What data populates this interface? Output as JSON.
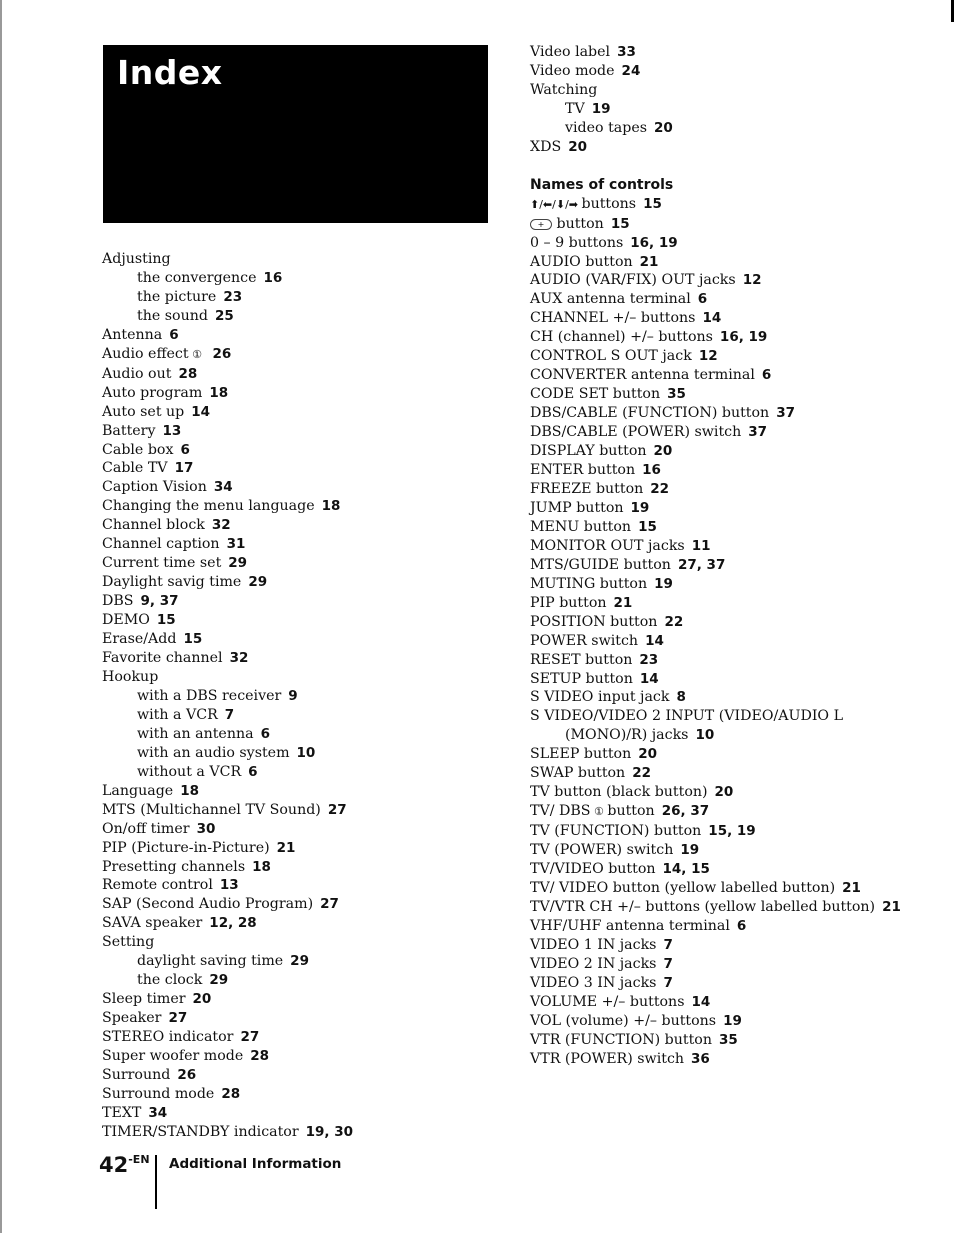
{
  "page": {
    "title": "Index",
    "footer": {
      "page_number": "42",
      "page_suffix": "-EN",
      "section": "Additional Information"
    }
  },
  "left_column": [
    {
      "term": "Adjusting",
      "pages": "",
      "level": 0
    },
    {
      "term": "the convergence",
      "pages": "16",
      "level": 1
    },
    {
      "term": "the picture",
      "pages": "23",
      "level": 1
    },
    {
      "term": "the sound",
      "pages": "25",
      "level": 1
    },
    {
      "term": "Antenna",
      "pages": "6",
      "level": 0
    },
    {
      "term": "Audio effect",
      "icon": "surround-icon",
      "icon_glyph": "①",
      "pages": "26",
      "level": 0
    },
    {
      "term": "Audio out",
      "pages": "28",
      "level": 0
    },
    {
      "term": "Auto program",
      "pages": "18",
      "level": 0
    },
    {
      "term": "Auto set up",
      "pages": "14",
      "level": 0
    },
    {
      "term": "Battery",
      "pages": "13",
      "level": 0
    },
    {
      "term": "Cable box",
      "pages": "6",
      "level": 0
    },
    {
      "term": "Cable TV",
      "pages": "17",
      "level": 0
    },
    {
      "term": "Caption Vision",
      "pages": "34",
      "level": 0
    },
    {
      "term": "Changing the menu language",
      "pages": "18",
      "level": 0
    },
    {
      "term": "Channel block",
      "pages": "32",
      "level": 0
    },
    {
      "term": "Channel caption",
      "pages": "31",
      "level": 0
    },
    {
      "term": "Current time set",
      "pages": "29",
      "level": 0
    },
    {
      "term": "Daylight savig time",
      "pages": "29",
      "level": 0
    },
    {
      "term": "DBS",
      "pages": "9, 37",
      "level": 0
    },
    {
      "term": "DEMO",
      "pages": "15",
      "level": 0
    },
    {
      "term": "Erase/Add",
      "pages": "15",
      "level": 0
    },
    {
      "term": "Favorite channel",
      "pages": "32",
      "level": 0
    },
    {
      "term": "Hookup",
      "pages": "",
      "level": 0
    },
    {
      "term": "with a DBS receiver",
      "pages": "9",
      "level": 1
    },
    {
      "term": "with a VCR",
      "pages": "7",
      "level": 1
    },
    {
      "term": "with an antenna",
      "pages": "6",
      "level": 1
    },
    {
      "term": "with an audio system",
      "pages": "10",
      "level": 1
    },
    {
      "term": "without a VCR",
      "pages": "6",
      "level": 1
    },
    {
      "term": "Language",
      "pages": "18",
      "level": 0
    },
    {
      "term": "MTS (Multichannel TV Sound)",
      "pages": "27",
      "level": 0
    },
    {
      "term": "On/off timer",
      "pages": "30",
      "level": 0
    },
    {
      "term": "PIP (Picture-in-Picture)",
      "pages": "21",
      "level": 0
    },
    {
      "term": "Presetting channels",
      "pages": "18",
      "level": 0
    },
    {
      "term": "Remote control",
      "pages": "13",
      "level": 0
    },
    {
      "term": "SAP (Second Audio Program)",
      "pages": "27",
      "level": 0
    },
    {
      "term": "SAVA speaker",
      "pages": "12, 28",
      "level": 0
    },
    {
      "term": "Setting",
      "pages": "",
      "level": 0
    },
    {
      "term": "daylight saving time",
      "pages": "29",
      "level": 1
    },
    {
      "term": "the clock",
      "pages": "29",
      "level": 1
    },
    {
      "term": "Sleep timer",
      "pages": "20",
      "level": 0
    },
    {
      "term": "Speaker",
      "pages": "27",
      "level": 0
    },
    {
      "term": "STEREO indicator",
      "pages": "27",
      "level": 0
    },
    {
      "term": "Super woofer mode",
      "pages": "28",
      "level": 0
    },
    {
      "term": "Surround",
      "pages": "26",
      "level": 0
    },
    {
      "term": "Surround mode",
      "pages": "28",
      "level": 0
    },
    {
      "term": "TEXT",
      "pages": "34",
      "level": 0
    },
    {
      "term": "TIMER/STANDBY indicator",
      "pages": "19, 30",
      "level": 0
    }
  ],
  "right_column": [
    {
      "term": "Video label",
      "pages": "33",
      "level": 0
    },
    {
      "term": "Video mode",
      "pages": "24",
      "level": 0
    },
    {
      "term": "Watching",
      "pages": "",
      "level": 0
    },
    {
      "term": "TV",
      "pages": "19",
      "level": 1
    },
    {
      "term": "video tapes",
      "pages": "20",
      "level": 1
    },
    {
      "term": "XDS",
      "pages": "20",
      "level": 0
    }
  ],
  "controls_section": {
    "heading": "Names of controls",
    "entries": [
      {
        "term": "buttons",
        "prefix_icons": "⬆/⬅/⬇/➡",
        "pages": "15",
        "level": 0
      },
      {
        "term": "button",
        "prefix_pill": "+",
        "pages": "15",
        "level": 0
      },
      {
        "term": "0 – 9 buttons",
        "pages": "16, 19",
        "level": 0
      },
      {
        "term": "AUDIO button",
        "pages": "21",
        "level": 0
      },
      {
        "term": "AUDIO (VAR/FIX) OUT jacks",
        "pages": "12",
        "level": 0
      },
      {
        "term": "AUX antenna terminal",
        "pages": "6",
        "level": 0
      },
      {
        "term": "CHANNEL +/– buttons",
        "pages": "14",
        "level": 0
      },
      {
        "term": "CH (channel) +/– buttons",
        "pages": "16, 19",
        "level": 0
      },
      {
        "term": "CONTROL S OUT jack",
        "pages": "12",
        "level": 0
      },
      {
        "term": "CONVERTER antenna terminal",
        "pages": "6",
        "level": 0
      },
      {
        "term": "CODE SET button",
        "pages": "35",
        "level": 0
      },
      {
        "term": "DBS/CABLE (FUNCTION) button",
        "pages": "37",
        "level": 0
      },
      {
        "term": "DBS/CABLE (POWER) switch",
        "pages": "37",
        "level": 0
      },
      {
        "term": "DISPLAY button",
        "pages": "20",
        "level": 0
      },
      {
        "term": "ENTER button",
        "pages": "16",
        "level": 0
      },
      {
        "term": "FREEZE button",
        "pages": "22",
        "level": 0
      },
      {
        "term": "JUMP button",
        "pages": "19",
        "level": 0
      },
      {
        "term": "MENU button",
        "pages": "15",
        "level": 0
      },
      {
        "term": "MONITOR OUT jacks",
        "pages": "11",
        "level": 0
      },
      {
        "term": "MTS/GUIDE button",
        "pages": "27, 37",
        "level": 0
      },
      {
        "term": "MUTING button",
        "pages": "19",
        "level": 0
      },
      {
        "term": "PIP button",
        "pages": "21",
        "level": 0
      },
      {
        "term": "POSITION button",
        "pages": "22",
        "level": 0
      },
      {
        "term": "POWER switch",
        "pages": "14",
        "level": 0
      },
      {
        "term": "RESET button",
        "pages": "23",
        "level": 0
      },
      {
        "term": "SETUP button",
        "pages": "14",
        "level": 0
      },
      {
        "term": "S VIDEO input jack",
        "pages": "8",
        "level": 0
      },
      {
        "term": "S VIDEO/VIDEO 2 INPUT (VIDEO/AUDIO  L",
        "pages": "",
        "level": 0
      },
      {
        "term": "(MONO)/R) jacks",
        "pages": "10",
        "level": 2
      },
      {
        "term": "SLEEP button",
        "pages": "20",
        "level": 0
      },
      {
        "term": "SWAP button",
        "pages": "22",
        "level": 0
      },
      {
        "term": "TV button (black button)",
        "pages": "20",
        "level": 0
      },
      {
        "term": "TV/ DBS",
        "icon": "surround-icon",
        "icon_glyph": "①",
        "term_after": "button",
        "pages": "26, 37",
        "level": 0
      },
      {
        "term": "TV (FUNCTION) button",
        "pages": "15, 19",
        "level": 0
      },
      {
        "term": "TV (POWER) switch",
        "pages": "19",
        "level": 0
      },
      {
        "term": "TV/VIDEO button",
        "pages": "14, 15",
        "level": 0
      },
      {
        "term": "TV/ VIDEO button (yellow labelled button)",
        "pages": "21",
        "level": 0
      },
      {
        "term": "TV/VTR CH +/– buttons (yellow labelled button)",
        "pages": "21",
        "level": 0
      },
      {
        "term": "VHF/UHF antenna terminal",
        "pages": "6",
        "level": 0
      },
      {
        "term": "VIDEO 1 IN jacks",
        "pages": "7",
        "level": 0
      },
      {
        "term": "VIDEO 2 IN jacks",
        "pages": "7",
        "level": 0
      },
      {
        "term": "VIDEO 3 IN jacks",
        "pages": "7",
        "level": 0
      },
      {
        "term": "VOLUME +/– buttons",
        "pages": "14",
        "level": 0
      },
      {
        "term": "VOL (volume) +/– buttons",
        "pages": "19",
        "level": 0
      },
      {
        "term": "VTR (FUNCTION) button",
        "pages": "35",
        "level": 0
      },
      {
        "term": "VTR (POWER) switch",
        "pages": "36",
        "level": 0
      }
    ]
  }
}
